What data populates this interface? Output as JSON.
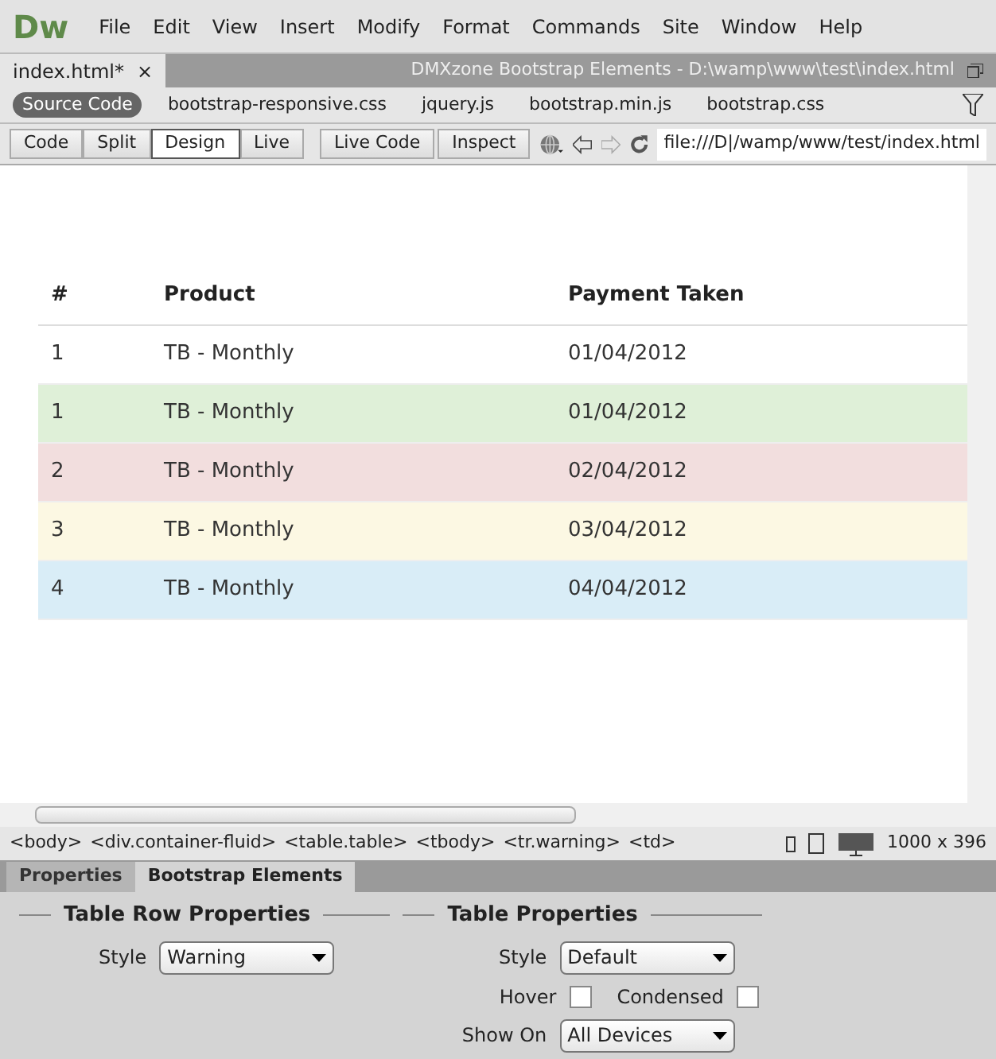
{
  "app": {
    "logo": "Dw",
    "menu": [
      "File",
      "Edit",
      "View",
      "Insert",
      "Modify",
      "Format",
      "Commands",
      "Site",
      "Window",
      "Help"
    ]
  },
  "document_tab": {
    "label": "index.html*",
    "close": "×",
    "title": "DMXzone Bootstrap Elements - D:\\wamp\\www\\test\\index.html"
  },
  "related_files": [
    {
      "label": "Source Code",
      "selected": true
    },
    {
      "label": "bootstrap-responsive.css",
      "selected": false
    },
    {
      "label": "jquery.js",
      "selected": false
    },
    {
      "label": "bootstrap.min.js",
      "selected": false
    },
    {
      "label": "bootstrap.css",
      "selected": false
    }
  ],
  "view_buttons": [
    {
      "label": "Code",
      "selected": false
    },
    {
      "label": "Split",
      "selected": false
    },
    {
      "label": "Design",
      "selected": true
    },
    {
      "label": "Live",
      "selected": false
    }
  ],
  "tool_buttons": [
    "Live Code",
    "Inspect"
  ],
  "address": {
    "value": "file:///D|/wamp/www/test/index.html"
  },
  "table": {
    "columns": [
      "#",
      "Product",
      "Payment Taken"
    ],
    "rows": [
      {
        "cells": [
          "1",
          "TB - Monthly",
          "01/04/2012"
        ],
        "color": "#ffffff"
      },
      {
        "cells": [
          "1",
          "TB - Monthly",
          "01/04/2012"
        ],
        "color": "#dff0d8"
      },
      {
        "cells": [
          "2",
          "TB - Monthly",
          "02/04/2012"
        ],
        "color": "#f2dede"
      },
      {
        "cells": [
          "3",
          "TB - Monthly",
          "03/04/2012"
        ],
        "color": "#fcf8e3"
      },
      {
        "cells": [
          "4",
          "TB - Monthly",
          "04/04/2012"
        ],
        "color": "#d9edf7"
      }
    ]
  },
  "tag_selector": [
    "<body>",
    "<div.container-fluid>",
    "<table.table>",
    "<tbody>",
    "<tr.warning>",
    "<td>"
  ],
  "window_size": "1000 x 396",
  "panel_tabs": [
    {
      "label": "Properties",
      "selected": false
    },
    {
      "label": "Bootstrap Elements",
      "selected": true
    }
  ],
  "row_properties": {
    "title": "Table Row Properties",
    "style_label": "Style",
    "style_value": "Warning"
  },
  "table_properties": {
    "title": "Table Properties",
    "style_label": "Style",
    "style_value": "Default",
    "hover": {
      "label": "Hover",
      "checked": false
    },
    "condensed": {
      "label": "Condensed",
      "checked": false
    },
    "show_on_label": "Show On",
    "show_on_value": "All Devices"
  }
}
